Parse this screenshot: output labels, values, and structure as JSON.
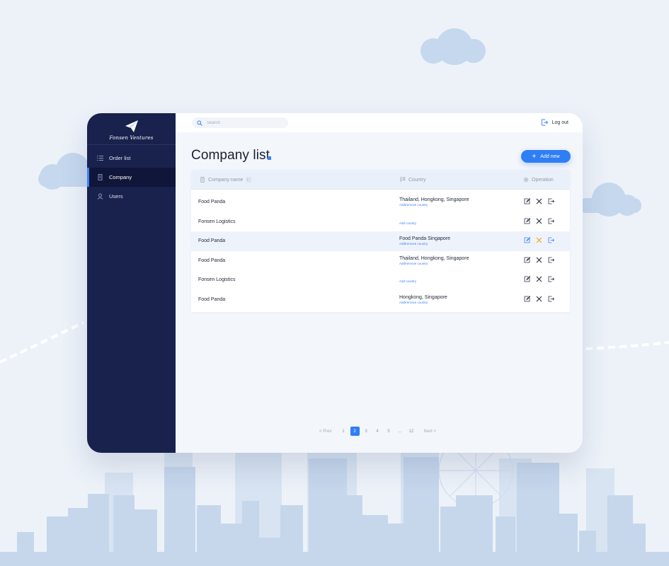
{
  "colors": {
    "background": "#edf2f9",
    "sidebar": "#19214d",
    "sidebar_active": "#0f1639",
    "accent": "#2f7ef5",
    "danger": "#f59e0b"
  },
  "brand": {
    "name": "Fonsen Ventures",
    "logo_icon": "paper-plane-icon"
  },
  "sidebar": {
    "items": [
      {
        "label": "Order list",
        "icon": "list-icon",
        "active": false
      },
      {
        "label": "Company",
        "icon": "building-icon",
        "active": true
      },
      {
        "label": "Users",
        "icon": "user-icon",
        "active": false
      }
    ]
  },
  "topbar": {
    "search_placeholder": "Search",
    "logout_label": "Log out"
  },
  "page": {
    "title": "Company list",
    "add_button_label": "Add new"
  },
  "table": {
    "columns": {
      "name": "Company name",
      "country": "Country",
      "operation": "Operation"
    },
    "rows": [
      {
        "name": "Food Panda",
        "country": "Thailand, Hongkong, Singapore",
        "link": "Add/remove country"
      },
      {
        "name": "Fonsen Logistics",
        "country": "",
        "link": "Add country"
      },
      {
        "name": "Food Panda",
        "country": "Food Panda Singapore",
        "link": "Add/remove country"
      },
      {
        "name": "Food Panda",
        "country": "Thailand, Hongkong, Singapore",
        "link": "Add/remove country"
      },
      {
        "name": "Fonsen Logistics",
        "country": "",
        "link": "Add country"
      },
      {
        "name": "Food Panda",
        "country": "Hongkong, Singapore",
        "link": "Add/remove country"
      }
    ]
  },
  "pagination": {
    "prev": "< Prev",
    "pages": [
      "1",
      "2",
      "3",
      "4",
      "5",
      "...",
      "12"
    ],
    "current_page": "2",
    "next": "Next >"
  }
}
